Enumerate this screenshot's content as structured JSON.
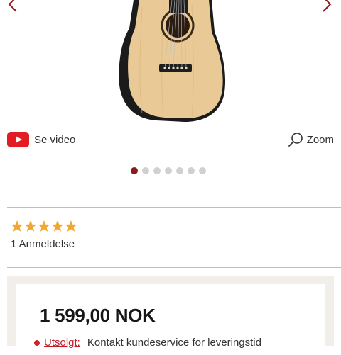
{
  "gallery": {
    "prev_icon": "chevron-left-icon",
    "next_icon": "chevron-right-icon",
    "dots_total": 7,
    "active_dot": 0,
    "active_color": "#8b1a1f"
  },
  "media": {
    "video_label": "Se video",
    "zoom_label": "Zoom",
    "video_icon": "youtube-icon",
    "zoom_icon": "search-icon"
  },
  "rating": {
    "stars": 5,
    "star_color": "#f0a830",
    "reviews_label": "1 Anmeldelse"
  },
  "price": {
    "amount": "1 599,00 NOK"
  },
  "stock": {
    "status": "Utsolgt:",
    "message": "Kontakt kundeservice for leveringstid",
    "status_color": "#c01d24"
  }
}
